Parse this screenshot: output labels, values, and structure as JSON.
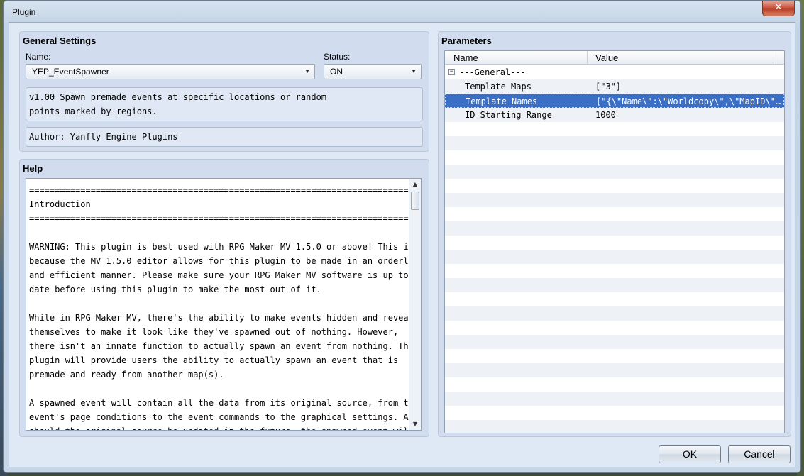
{
  "window": {
    "title": "Plugin",
    "close_glyph": "✕"
  },
  "general": {
    "title": "General Settings",
    "name_label": "Name:",
    "name_value": "YEP_EventSpawner",
    "status_label": "Status:",
    "status_value": "ON",
    "description": "v1.00 Spawn premade events at specific locations or random\npoints marked by regions.",
    "author": "Author: Yanfly Engine Plugins"
  },
  "help": {
    "title": "Help",
    "text": "==========================================================================\nIntroduction\n==========================================================================\n\nWARNING: This plugin is best used with RPG Maker MV 1.5.0 or above! This is\nbecause the MV 1.5.0 editor allows for this plugin to be made in an orderly\nand efficient manner. Please make sure your RPG Maker MV software is up to\ndate before using this plugin to make the most out of it.\n\nWhile in RPG Maker MV, there's the ability to make events hidden and reveal\nthemselves to make it look like they've spawned out of nothing. However,\nthere isn't an innate function to actually spawn an event from nothing. This\nplugin will provide users the ability to actually spawn an event that is\npremade and ready from another map(s).\n\nA spawned event will contain all the data from its original source, from the\nevent's page conditions to the event commands to the graphical settings. And\nshould the original source be updated in the future, the spawned event will"
  },
  "parameters": {
    "title": "Parameters",
    "col_name": "Name",
    "col_value": "Value",
    "group_label": "---General---",
    "rows": [
      {
        "name": "Template Maps",
        "value": "[\"3\"]"
      },
      {
        "name": "Template Names",
        "value": "[\"{\\\"Name\\\":\\\"Worldcopy\\\",\\\"MapID\\\"…"
      },
      {
        "name": "ID Starting Range",
        "value": "1000"
      }
    ]
  },
  "buttons": {
    "ok": "OK",
    "cancel": "Cancel"
  },
  "colors": {
    "selection": "#3b6fc6",
    "close": "#c7503a"
  }
}
